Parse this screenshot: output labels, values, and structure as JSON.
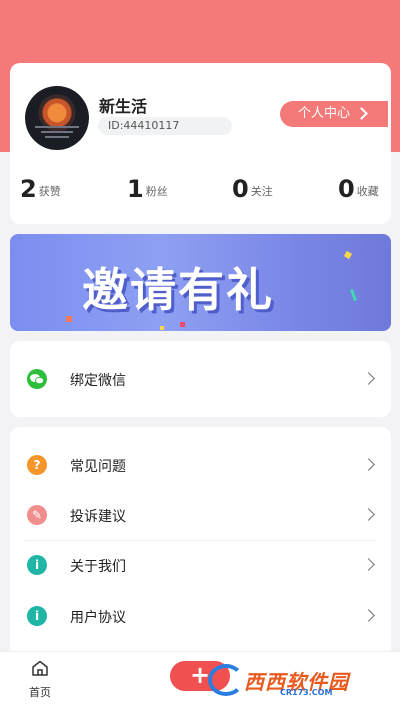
{
  "profile": {
    "name": "新生活",
    "id_text": "ID:44410117",
    "center_label": "个人中心"
  },
  "stats": [
    {
      "value": "2",
      "label": "获赞"
    },
    {
      "value": "1",
      "label": "粉丝"
    },
    {
      "value": "0",
      "label": "关注"
    },
    {
      "value": "0",
      "label": "收藏"
    }
  ],
  "banner": {
    "text": "邀请有礼"
  },
  "wechat": {
    "label": "绑定微信",
    "icon": "wechat-icon",
    "color": "#2dbf3c"
  },
  "menu": [
    {
      "label": "常见问题",
      "icon": "question-icon",
      "glyph": "?",
      "color": "#f5962a"
    },
    {
      "label": "投诉建议",
      "icon": "feedback-icon",
      "glyph": "✎",
      "color": "#f08d8d"
    },
    {
      "label": "关于我们",
      "icon": "info-icon",
      "glyph": "i",
      "color": "#1fb6a6"
    },
    {
      "label": "用户协议",
      "icon": "info-icon",
      "glyph": "i",
      "color": "#1fb6a6"
    }
  ],
  "tabbar": {
    "home_label": "首页",
    "fab_glyph": "+"
  },
  "watermark": {
    "text": "西西软件园",
    "sub": "CR173.COM"
  },
  "colors": {
    "accent": "#f47a7a",
    "background": "#f3f3f5"
  }
}
